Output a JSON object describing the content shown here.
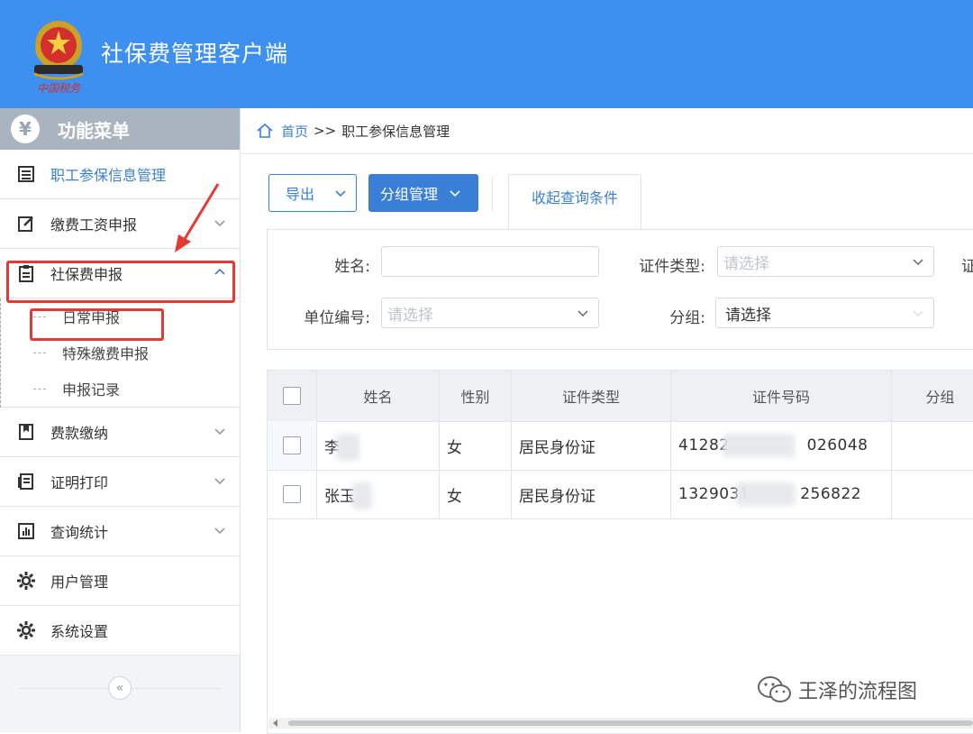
{
  "app": {
    "title": "社保费管理客户端",
    "logo_text": "中国税务"
  },
  "sidebar": {
    "menu_title": "功能菜单",
    "menu_icon_glyph": "¥",
    "collapse_glyph": "«",
    "items": [
      {
        "label": "职工参保信息管理",
        "icon": "list-icon",
        "active": true
      },
      {
        "label": "缴费工资申报",
        "icon": "edit-icon",
        "expandable": true
      },
      {
        "label": "社保费申报",
        "icon": "clipboard-icon",
        "expandable": true,
        "expanded": true
      },
      {
        "label": "费款缴纳",
        "icon": "bookmark-icon",
        "expandable": true
      },
      {
        "label": "证明打印",
        "icon": "document-icon",
        "expandable": true
      },
      {
        "label": "查询统计",
        "icon": "bar-chart-icon",
        "expandable": true
      },
      {
        "label": "用户管理",
        "icon": "gear-icon"
      },
      {
        "label": "系统设置",
        "icon": "gear-icon"
      }
    ],
    "subitems": [
      {
        "label": "日常申报"
      },
      {
        "label": "特殊缴费申报"
      },
      {
        "label": "申报记录"
      }
    ]
  },
  "breadcrumb": {
    "home": "首页",
    "separator": ">>",
    "current": "职工参保信息管理"
  },
  "toolbar": {
    "export_label": "导出",
    "group_label": "分组管理",
    "tab_label": "收起查询条件"
  },
  "query": {
    "name_label": "姓名:",
    "name_value": "",
    "id_type_label": "证件类型:",
    "id_type_placeholder": "请选择",
    "third_label_partial": "证",
    "unit_label": "单位编号:",
    "unit_placeholder": "请选择",
    "group_label": "分组:",
    "group_value": "请选择"
  },
  "table": {
    "columns": [
      "姓名",
      "性别",
      "证件类型",
      "证件号码",
      "分组"
    ],
    "rows": [
      {
        "name": "李",
        "gender": "女",
        "id_type": "居民身份证",
        "id_prefix": "41282",
        "id_suffix": "026048",
        "group": ""
      },
      {
        "name": "张玉",
        "gender": "女",
        "id_type": "居民身份证",
        "id_prefix": "1329031",
        "id_suffix": "256822",
        "group": ""
      }
    ]
  },
  "watermark": {
    "text": "王泽的流程图"
  },
  "colors": {
    "header_blue": "#3d8ff0",
    "accent": "#3a7fd6",
    "annotation_red": "#e53935"
  }
}
